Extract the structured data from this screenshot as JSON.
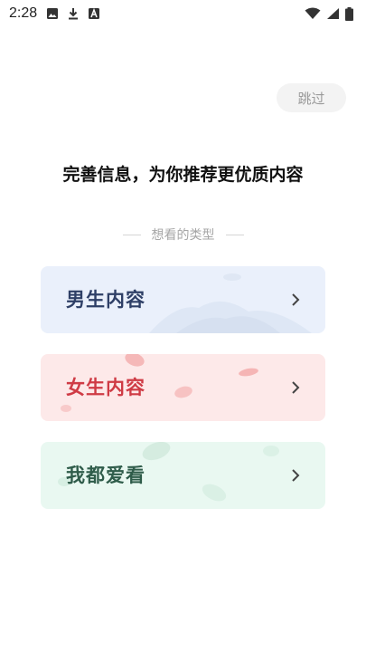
{
  "status_bar": {
    "time": "2:28",
    "icons": [
      "image-icon",
      "download-icon",
      "text-a-icon",
      "wifi-icon",
      "signal-icon",
      "battery-icon"
    ]
  },
  "skip_label": "跳过",
  "headline": "完善信息，为你推荐更优质内容",
  "subheading": "想看的类型",
  "options": [
    {
      "label": "男生内容",
      "bg": "#eaf0fb",
      "text_color": "#2e3f66"
    },
    {
      "label": "女生内容",
      "bg": "#fde9e9",
      "text_color": "#cf3b45"
    },
    {
      "label": "我都爱看",
      "bg": "#e9f8f1",
      "text_color": "#2f5c4a"
    }
  ]
}
